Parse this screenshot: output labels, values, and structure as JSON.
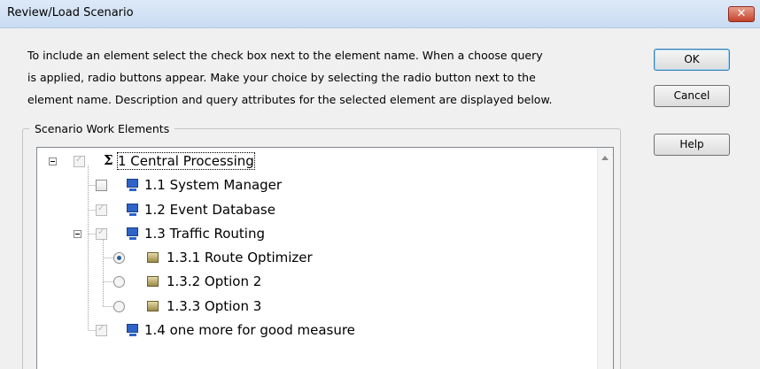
{
  "window": {
    "title": "Review/Load Scenario",
    "close_glyph": "✕"
  },
  "instructions": {
    "line1": "To include an element select the check box next to the element name. When a choose query",
    "line2": "is applied, radio buttons appear. Make your choice by selecting the radio button next to the",
    "line3": "element name. Description and query attributes for the selected element are displayed below."
  },
  "buttons": {
    "ok": "OK",
    "cancel": "Cancel",
    "help": "Help"
  },
  "group": {
    "label": "Scenario Work Elements"
  },
  "tree": {
    "items": [
      {
        "label": "1 Central Processing",
        "control": "checkbox",
        "checked": true,
        "enabled": false,
        "icon": "sigma-icon",
        "expanded": true,
        "selected": true
      },
      {
        "label": "1.1 System Manager",
        "control": "checkbox",
        "checked": false,
        "enabled": true,
        "icon": "computer-icon"
      },
      {
        "label": "1.2 Event Database",
        "control": "checkbox",
        "checked": true,
        "enabled": false,
        "icon": "computer-icon"
      },
      {
        "label": "1.3 Traffic Routing",
        "control": "checkbox",
        "checked": true,
        "enabled": false,
        "icon": "computer-icon",
        "expanded": true
      },
      {
        "label": "1.3.1 Route Optimizer",
        "control": "radio",
        "checked": true,
        "icon": "package-icon"
      },
      {
        "label": "1.3.2 Option 2",
        "control": "radio",
        "checked": false,
        "icon": "package-icon"
      },
      {
        "label": "1.3.3 Option 3",
        "control": "radio",
        "checked": false,
        "icon": "package-icon"
      },
      {
        "label": "1.4 one more for good measure",
        "control": "checkbox",
        "checked": true,
        "enabled": false,
        "icon": "computer-icon"
      }
    ]
  }
}
